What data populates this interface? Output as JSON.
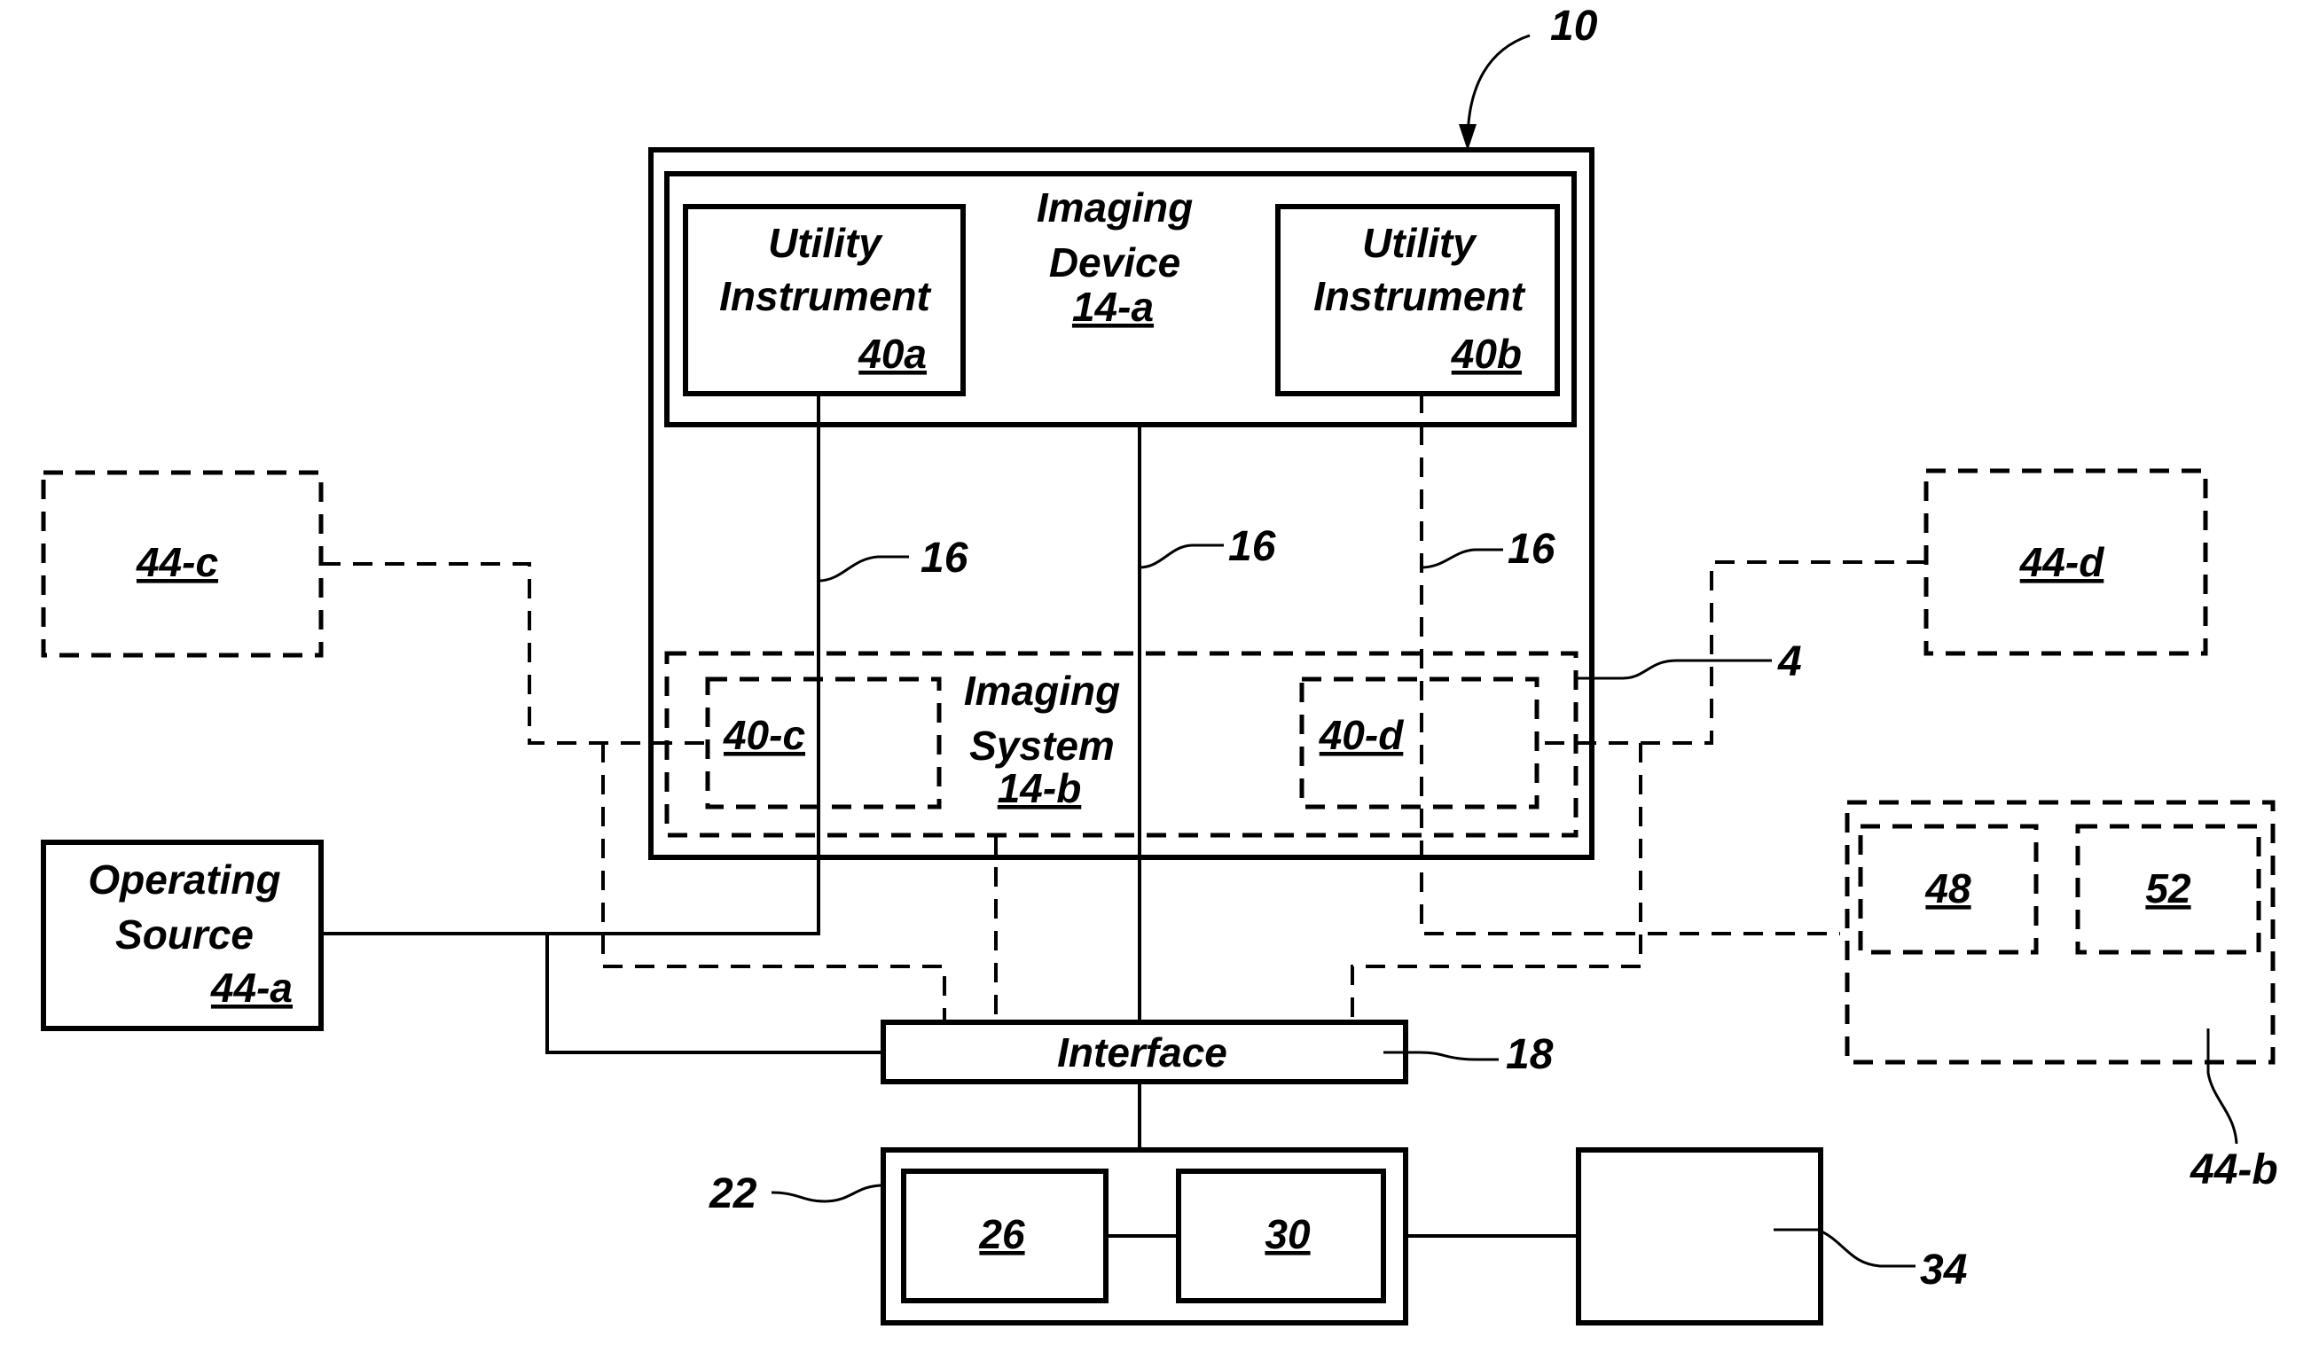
{
  "diagram": {
    "system_ref": "10",
    "imaging_device": {
      "line1": "Imaging",
      "line2": "Device",
      "ref": "14-a"
    },
    "utility_a": {
      "line1": "Utility",
      "line2": "Instrument",
      "ref": "40a"
    },
    "utility_b": {
      "line1": "Utility",
      "line2": "Instrument",
      "ref": "40b"
    },
    "imaging_system": {
      "line1": "Imaging",
      "line2": "System",
      "ref": "14-b",
      "callout": "4"
    },
    "sub_c": {
      "ref": "40-c"
    },
    "sub_d": {
      "ref": "40-d"
    },
    "ext_c": {
      "ref": "44-c"
    },
    "ext_d": {
      "ref": "44-d"
    },
    "operating_source": {
      "line1": "Operating",
      "line2": "Source",
      "ref": "44-a"
    },
    "ext_b": {
      "ref": "44-b",
      "inner_left": "48",
      "inner_right": "52"
    },
    "connection_ref": "16",
    "interface": {
      "label": "Interface",
      "ref": "18"
    },
    "controller": {
      "ref": "22",
      "left": "26",
      "right": "30"
    },
    "output_ref": "34"
  }
}
